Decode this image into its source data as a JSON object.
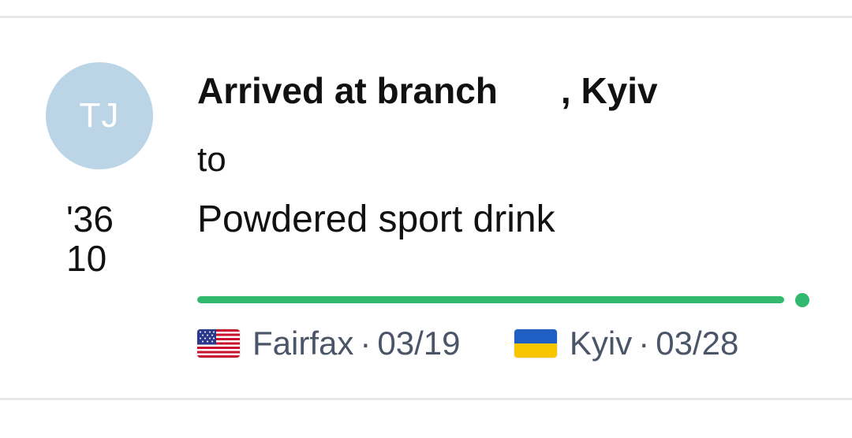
{
  "sender": {
    "initials": "TJ",
    "avatar_color": "#bcd5e6"
  },
  "date": {
    "line1": "'36",
    "line2": "10"
  },
  "shipment": {
    "status_prefix": "Arrived at branch",
    "status_suffix": ", Kyiv",
    "connector": "to",
    "item_name": "Powdered sport drink"
  },
  "progress": {
    "fraction": 1.0,
    "color": "#33b86f"
  },
  "route": {
    "origin": {
      "flag_icon": "us-flag-icon",
      "city": "Fairfax",
      "separator": "·",
      "date": "03/19"
    },
    "destination": {
      "flag_icon": "ukraine-flag-icon",
      "city": "Kyiv",
      "separator": "·",
      "date": "03/28"
    }
  }
}
